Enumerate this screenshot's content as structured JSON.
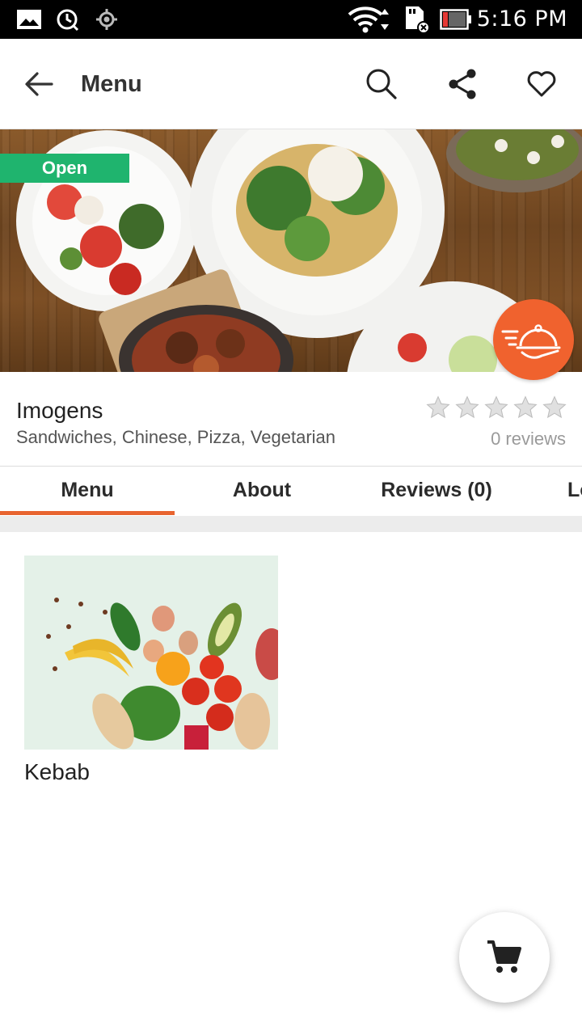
{
  "status_bar": {
    "time": "5:16 PM",
    "icons": [
      "image-icon",
      "clock-sync-icon",
      "location-icon",
      "wifi-icon",
      "sd-card-icon",
      "battery-icon"
    ]
  },
  "app_bar": {
    "title": "Menu",
    "actions": [
      "back-icon",
      "search-icon",
      "share-icon",
      "heart-icon"
    ]
  },
  "restaurant": {
    "status_badge": "Open",
    "name": "Imogens",
    "cuisines": "Sandwiches, Chinese, Pizza, Vegetarian",
    "rating": 0,
    "rating_max": 5,
    "reviews_label": "0 reviews"
  },
  "tabs": [
    {
      "label": "Menu",
      "active": true
    },
    {
      "label": "About",
      "active": false
    },
    {
      "label": "Reviews (0)",
      "active": false
    },
    {
      "label": "Lo",
      "active": false
    }
  ],
  "menu_items": [
    {
      "title": "Kebab"
    }
  ],
  "colors": {
    "accent": "#e8642f",
    "open_badge": "#1fb46e",
    "delivery_fab": "#f0622e"
  }
}
